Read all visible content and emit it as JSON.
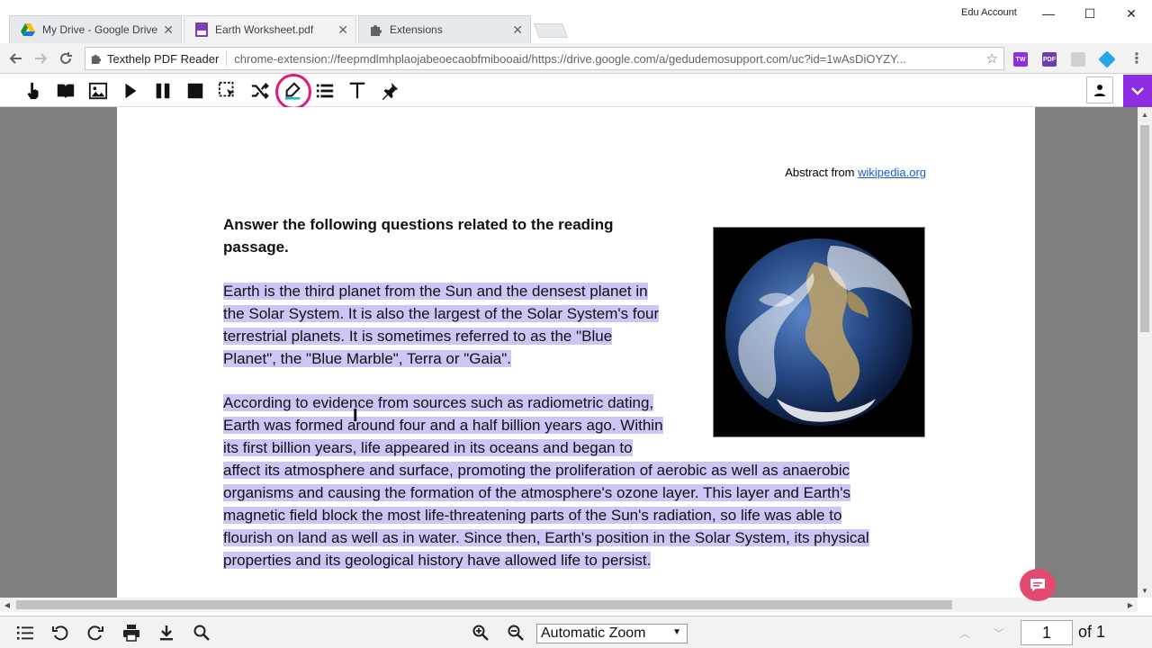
{
  "browser": {
    "tabs": [
      {
        "title": "My Drive - Google Drive",
        "icon": "google-drive-icon"
      },
      {
        "title": "Earth Worksheet.pdf",
        "icon": "pdf-icon"
      },
      {
        "title": "Extensions",
        "icon": "puzzle-icon"
      }
    ],
    "close_glyph": "✕",
    "account": "Edu Account",
    "window_controls": {
      "minimize": "—",
      "maximize": "☐",
      "close": "✕"
    },
    "address": {
      "site_chip": "Texthelp PDF Reader",
      "url": "chrome-extension://feepmdlmhplaojabeoecaobfmibooaid/https://drive.google.com/a/gedudemosupport.com/uc?id=1wAsDiOYZY..."
    }
  },
  "texthelp_toolbar": {
    "tools": [
      "hand-pointer-icon",
      "book-icon",
      "image-icon",
      "play-icon",
      "pause-icon",
      "stop-icon",
      "screen-selection-icon",
      "shuffle-icon",
      "highlighter-icon",
      "list-icon",
      "text-icon",
      "pin-icon"
    ],
    "active_tool": "highlighter-icon",
    "ring_color": "#e0197d",
    "accent_color": "#8e2de2"
  },
  "document": {
    "abstract_prefix": "Abstract from ",
    "abstract_link": "wikipedia.org",
    "question_line1": "Answer the following questions related to the reading",
    "question_line2": "passage.",
    "para1": [
      "Earth is the third planet from the Sun and the densest planet in",
      "the Solar System. It is also the largest of the Solar System's four",
      "terrestrial planets. It is sometimes referred to as the \"Blue",
      "Planet\", the \"Blue Marble\", Terra or \"Gaia\"."
    ],
    "para2": [
      "According to evidence from sources such as radiometric dating,",
      "Earth was formed around four and a half billion years ago. Within",
      "its first billion years, life appeared in its oceans and began to",
      "affect its atmosphere and surface, promoting the proliferation of aerobic as well as anaerobic",
      "organisms and causing the formation of the atmosphere's ozone layer. This layer and Earth's",
      "magnetic field block the most life-threatening parts of the Sun's radiation, so life was able to",
      "flourish on land as well as in water. Since then, Earth's position in the Solar System, its physical",
      "properties and its geological history have allowed life to persist."
    ],
    "highlight_color": "#cbc6f5"
  },
  "bottom_bar": {
    "zoom": "Automatic Zoom",
    "page_number": "1",
    "page_total": "of 1"
  }
}
